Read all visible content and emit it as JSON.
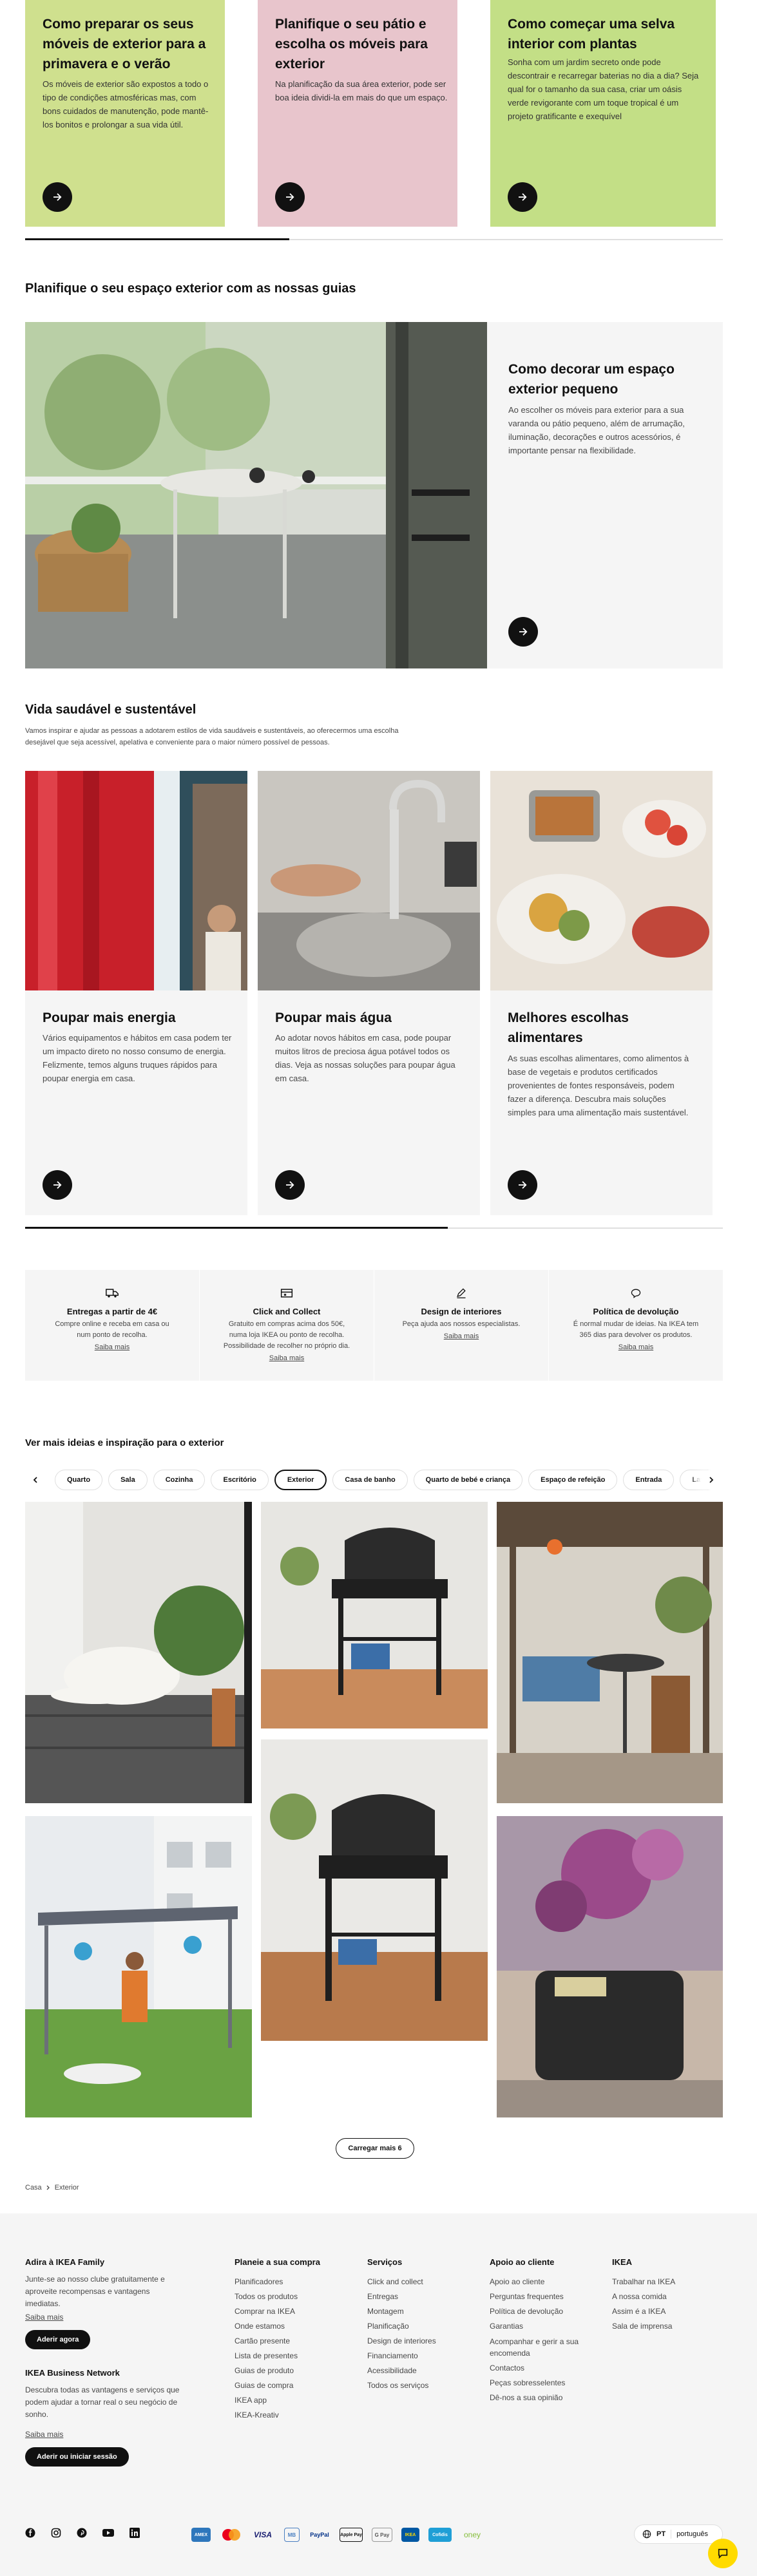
{
  "top_cards": [
    {
      "title": "Como preparar os seus móveis de exterior para a primavera e o verão",
      "text": "Os móveis de exterior são expostos a todo o tipo de condições atmosféricas mas, com bons cuidados de manutenção, pode mantê-los bonitos e prolongar a sua vida útil.",
      "color": "#cfe08e"
    },
    {
      "title": "Planifique o seu pátio e escolha os móveis para exterior",
      "text": "Na planificação da sua área exterior, pode ser boa ideia dividi-la em mais do que um espaço.",
      "color": "#e8c5cc"
    },
    {
      "title": "Como começar uma selva interior com plantas",
      "text": "Sonha com um jardim secreto onde pode descontrair e recarregar baterias no dia a dia? Seja qual for o tamanho da sua casa, criar um oásis verde revigorante com um toque tropical é um projeto gratificante e exequível",
      "color": "#c3df86"
    }
  ],
  "guides": {
    "heading": "Planifique o seu espaço exterior com as nossas guias",
    "card_title": "Como decorar um espaço exterior pequeno",
    "card_text": "Ao escolher os móveis para exterior para a sua varanda ou pátio pequeno, além de arrumação, iluminação, decorações e outros acessórios, é importante pensar na flexibilidade."
  },
  "sustainable": {
    "heading": "Vida saudável e sustentável",
    "intro": "Vamos inspirar e ajudar as pessoas a adotarem estilos de vida saudáveis e sustentáveis, ao oferecermos uma escolha desejável que seja acessível, apelativa e conveniente para o maior número possível de pessoas.",
    "cards": [
      {
        "title": "Poupar mais energia",
        "text": "Vários equipamentos e hábitos em casa podem ter um impacto direto no nosso consumo de energia. Felizmente, temos alguns truques rápidos para poupar energia em casa."
      },
      {
        "title": "Poupar mais água",
        "text": "Ao adotar novos hábitos em casa, pode poupar muitos litros de preciosa água potável todos os dias. Veja as nossas soluções para poupar água em casa."
      },
      {
        "title": "Melhores escolhas alimentares",
        "text": "As suas escolhas alimentares, como alimentos à base de vegetais e produtos certificados provenientes de fontes responsáveis, podem fazer a diferença. Descubra mais soluções simples para uma alimentação mais sustentável."
      }
    ]
  },
  "usps": [
    {
      "icon": "truck-icon",
      "title": "Entregas a partir de 4€",
      "text": "Compre online e receba em casa ou num ponto de recolha.",
      "link": "Saiba mais"
    },
    {
      "icon": "store-icon",
      "title": "Click and Collect",
      "text": "Gratuito em compras acima dos 50€, numa loja IKEA ou ponto de recolha. Possibilidade de recolher no próprio dia.",
      "link": "Saiba mais"
    },
    {
      "icon": "pencil-icon",
      "title": "Design de interiores",
      "text": "Peça ajuda aos nossos especialistas.",
      "link": "Saiba mais"
    },
    {
      "icon": "return-icon",
      "title": "Política de devolução",
      "text": "É normal mudar de ideias. Na IKEA tem 365 dias para devolver os produtos.",
      "link": "Saiba mais"
    }
  ],
  "inspiration": {
    "heading": "Ver mais ideias e inspiração para o exterior",
    "chips": [
      "Quarto",
      "Sala",
      "Cozinha",
      "Escritório",
      "Exterior",
      "Casa de banho",
      "Quarto de bebé e criança",
      "Espaço de refeição",
      "Entrada",
      "Lava"
    ],
    "active_chip": "Exterior",
    "load_more": "Carregar mais 6"
  },
  "breadcrumb": [
    "Casa",
    "Exterior"
  ],
  "footer": {
    "family_title": "Adira à IKEA Family",
    "family_text": "Junte-se ao nosso clube gratuitamente e aproveite recompensas e vantagens imediatas.",
    "family_link": "Saiba mais",
    "family_button": "Aderir agora",
    "business_title": "IKEA Business Network",
    "business_text": "Descubra todas as vantagens e serviços que podem ajudar a tornar real o seu negócio de sonho.",
    "business_link": "Saiba mais",
    "business_button": "Aderir ou iniciar sessão",
    "columns": [
      {
        "title": "Planeie a sua compra",
        "links": [
          "Planificadores",
          "Todos os produtos",
          "Comprar na IKEA",
          "Onde estamos",
          "Cartão presente",
          "Lista de presentes",
          "Guias de produto",
          "Guias de compra",
          "IKEA app",
          "IKEA-Kreativ"
        ]
      },
      {
        "title": "Serviços",
        "links": [
          "Click and collect",
          "Entregas",
          "Montagem",
          "Planificação",
          "Design de interiores",
          "Financiamento",
          "Acessibilidade",
          "Todos os serviços"
        ]
      },
      {
        "title": "Apoio ao cliente",
        "links": [
          "Apoio ao cliente",
          "Perguntas frequentes",
          "Política de devolução",
          "Garantias",
          "Acompanhar e gerir a sua encomenda",
          "Contactos",
          "Peças sobresselentes",
          "Dê-nos a sua opinião"
        ]
      },
      {
        "title": "IKEA",
        "links": [
          "Trabalhar na IKEA",
          "A nossa comida",
          "Assim é a IKEA",
          "Sala de imprensa"
        ]
      }
    ],
    "social_icons": [
      "facebook-icon",
      "instagram-icon",
      "pinterest-icon",
      "youtube-icon",
      "linkedin-icon"
    ],
    "payments": [
      "AMEX",
      "MC",
      "VISA",
      "MB",
      "PayPal",
      "Apple Pay",
      "G Pay",
      "IKEA",
      "Cofidis",
      "oney"
    ],
    "language_country": "PT",
    "language_label": "português"
  }
}
